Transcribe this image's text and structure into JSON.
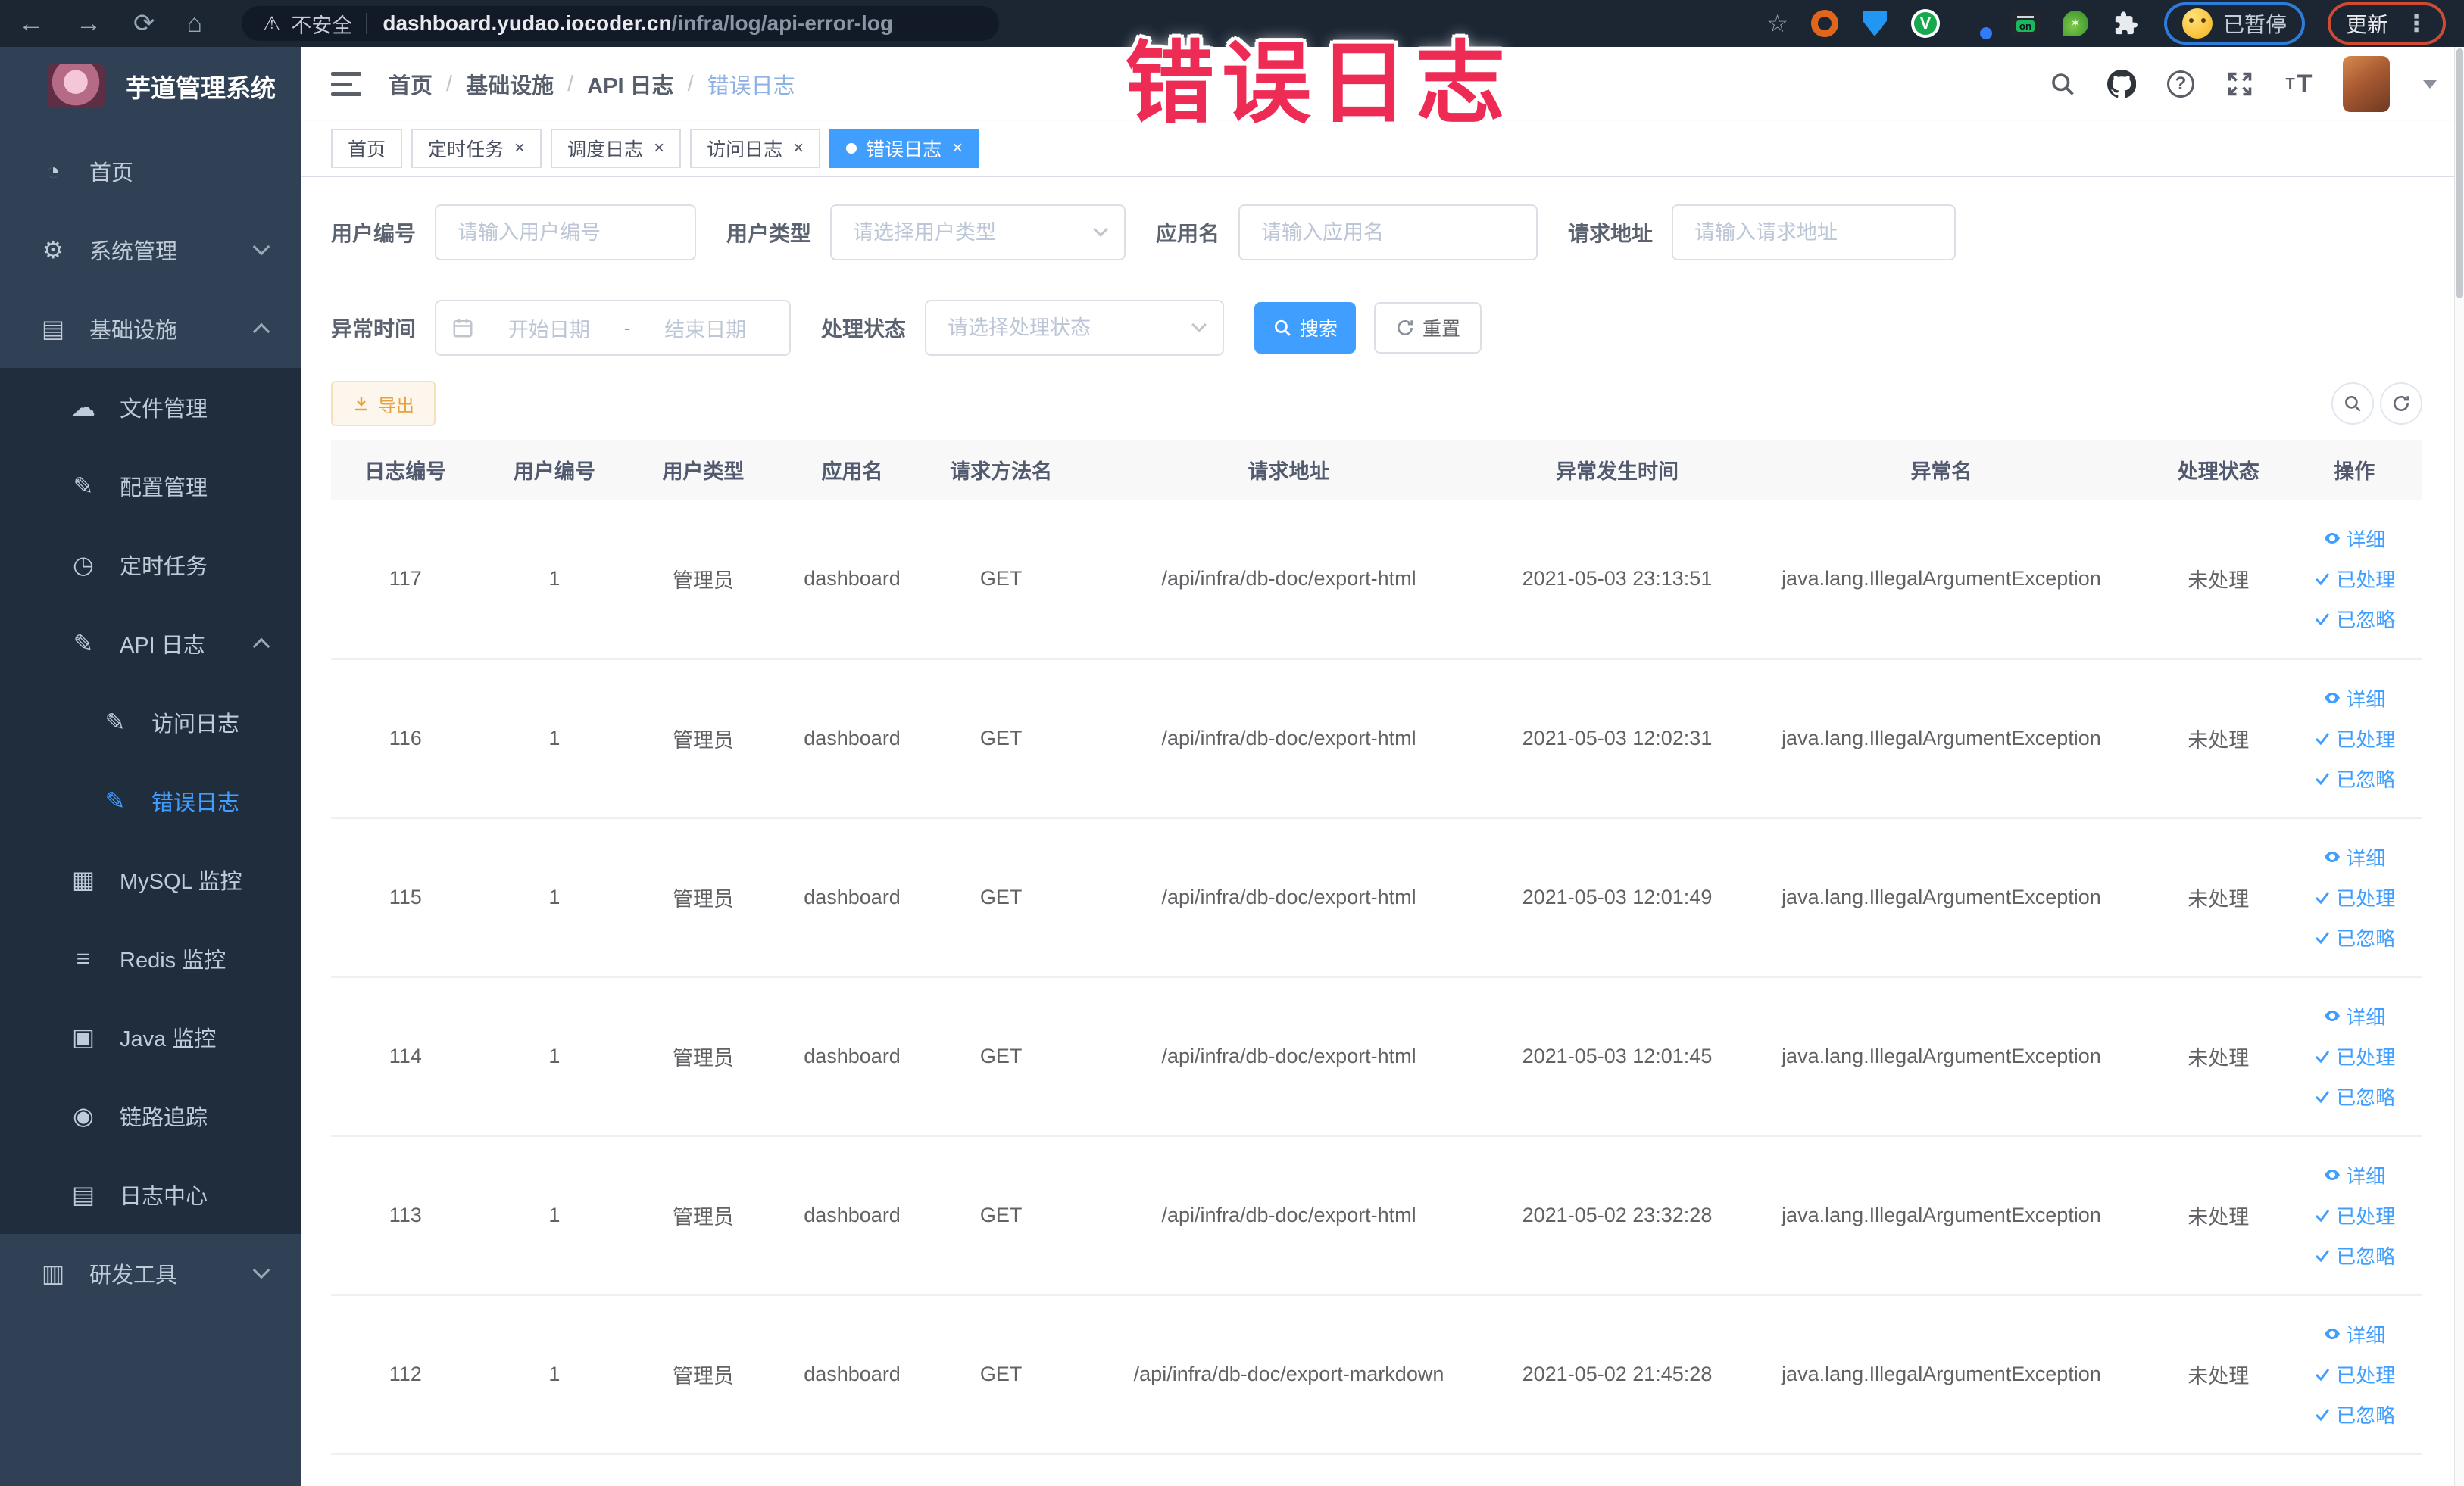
{
  "browser": {
    "security_label": "不安全",
    "url_domain": "dashboard.yudao.iocoder.cn",
    "url_path": "/infra/log/api-error-log",
    "profile_chip_label": "已暂停",
    "update_button_label": "更新"
  },
  "annotation": {
    "text": "错误日志",
    "color": "#ee2b54"
  },
  "sidebar": {
    "logo_title": "芋道管理系统",
    "items": [
      {
        "label": "首页",
        "depth": 0,
        "icon": "dashboard-icon"
      },
      {
        "label": "系统管理",
        "depth": 0,
        "icon": "gear-icon",
        "chevron": "down"
      },
      {
        "label": "基础设施",
        "depth": 0,
        "icon": "monitor-icon",
        "chevron": "up"
      },
      {
        "label": "文件管理",
        "depth": 1,
        "icon": "file-icon",
        "submenu": true
      },
      {
        "label": "配置管理",
        "depth": 1,
        "icon": "edit-icon",
        "submenu": true
      },
      {
        "label": "定时任务",
        "depth": 1,
        "icon": "clock-icon",
        "submenu": true
      },
      {
        "label": "API 日志",
        "depth": 1,
        "icon": "log-icon",
        "chevron": "up",
        "submenu": true
      },
      {
        "label": "访问日志",
        "depth": 2,
        "icon": "log-icon",
        "submenu": true
      },
      {
        "label": "错误日志",
        "depth": 2,
        "icon": "log-icon",
        "submenu": true,
        "active": true
      },
      {
        "label": "MySQL 监控",
        "depth": 1,
        "icon": "table-icon",
        "submenu": true
      },
      {
        "label": "Redis 监控",
        "depth": 1,
        "icon": "database-icon",
        "submenu": true
      },
      {
        "label": "Java 监控",
        "depth": 1,
        "icon": "java-monitor-icon",
        "submenu": true
      },
      {
        "label": "链路追踪",
        "depth": 1,
        "icon": "eye-icon",
        "submenu": true
      },
      {
        "label": "日志中心",
        "depth": 1,
        "icon": "log-center-icon",
        "submenu": true
      },
      {
        "label": "研发工具",
        "depth": 0,
        "icon": "toolbox-icon",
        "chevron": "down"
      }
    ]
  },
  "breadcrumb": {
    "items": [
      "首页",
      "基础设施",
      "API 日志",
      "错误日志"
    ]
  },
  "tabs": [
    {
      "label": "首页",
      "closable": false,
      "active": false
    },
    {
      "label": "定时任务",
      "closable": true,
      "active": false
    },
    {
      "label": "调度日志",
      "closable": true,
      "active": false
    },
    {
      "label": "访问日志",
      "closable": true,
      "active": false
    },
    {
      "label": "错误日志",
      "closable": true,
      "active": true
    }
  ],
  "filters": {
    "user_id": {
      "label": "用户编号",
      "placeholder": "请输入用户编号"
    },
    "user_type": {
      "label": "用户类型",
      "placeholder": "请选择用户类型"
    },
    "app_name": {
      "label": "应用名",
      "placeholder": "请输入应用名"
    },
    "request_url": {
      "label": "请求地址",
      "placeholder": "请输入请求地址"
    },
    "exception_time": {
      "label": "异常时间",
      "start_placeholder": "开始日期",
      "separator": "-",
      "end_placeholder": "结束日期"
    },
    "process_status": {
      "label": "处理状态",
      "placeholder": "请选择处理状态"
    },
    "search_button": "搜索",
    "reset_button": "重置"
  },
  "toolbar": {
    "export_button": "导出"
  },
  "table": {
    "columns": [
      "日志编号",
      "用户编号",
      "用户类型",
      "应用名",
      "请求方法名",
      "请求地址",
      "异常发生时间",
      "异常名",
      "处理状态",
      "操作"
    ],
    "col_widths": [
      "7.12%",
      "7.12%",
      "7.12%",
      "7.12%",
      "7.12%",
      "20.4%",
      "11%",
      "20%",
      "6.5%",
      "6.5%"
    ],
    "actions": [
      "详细",
      "已处理",
      "已忽略"
    ],
    "rows": [
      {
        "id": "117",
        "user_id": "1",
        "user_type": "管理员",
        "app": "dashboard",
        "method": "GET",
        "url": "/api/infra/db-doc/export-html",
        "time": "2021-05-03 23:13:51",
        "exception": "java.lang.IllegalArgumentException",
        "status": "未处理"
      },
      {
        "id": "116",
        "user_id": "1",
        "user_type": "管理员",
        "app": "dashboard",
        "method": "GET",
        "url": "/api/infra/db-doc/export-html",
        "time": "2021-05-03 12:02:31",
        "exception": "java.lang.IllegalArgumentException",
        "status": "未处理"
      },
      {
        "id": "115",
        "user_id": "1",
        "user_type": "管理员",
        "app": "dashboard",
        "method": "GET",
        "url": "/api/infra/db-doc/export-html",
        "time": "2021-05-03 12:01:49",
        "exception": "java.lang.IllegalArgumentException",
        "status": "未处理"
      },
      {
        "id": "114",
        "user_id": "1",
        "user_type": "管理员",
        "app": "dashboard",
        "method": "GET",
        "url": "/api/infra/db-doc/export-html",
        "time": "2021-05-03 12:01:45",
        "exception": "java.lang.IllegalArgumentException",
        "status": "未处理"
      },
      {
        "id": "113",
        "user_id": "1",
        "user_type": "管理员",
        "app": "dashboard",
        "method": "GET",
        "url": "/api/infra/db-doc/export-html",
        "time": "2021-05-02 23:32:28",
        "exception": "java.lang.IllegalArgumentException",
        "status": "未处理"
      },
      {
        "id": "112",
        "user_id": "1",
        "user_type": "管理员",
        "app": "dashboard",
        "method": "GET",
        "url": "/api/infra/db-doc/export-markdown",
        "time": "2021-05-02 21:45:28",
        "exception": "java.lang.IllegalArgumentException",
        "status": "未处理"
      }
    ]
  },
  "colors": {
    "accent": "#409eff",
    "warning": "#e6a23c",
    "sidebar_bg": "#304156",
    "submenu_bg": "#1f2d3d"
  }
}
